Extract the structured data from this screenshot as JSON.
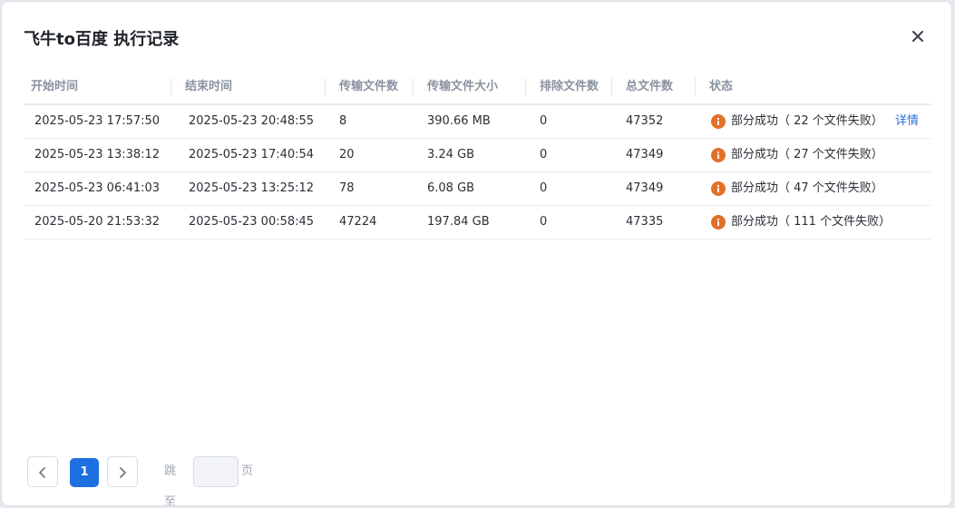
{
  "dialog": {
    "title": "飞牛to百度 执行记录"
  },
  "table": {
    "headers": [
      "开始时间",
      "结束时间",
      "传输文件数",
      "传输文件大小",
      "排除文件数",
      "总文件数",
      "状态"
    ],
    "rows": [
      {
        "start": "2025-05-23 17:57:50",
        "end": "2025-05-23 20:48:55",
        "transferred": "8",
        "size": "390.66 MB",
        "excluded": "0",
        "total": "47352",
        "status": "部分成功（ 22 个文件失败）",
        "detail": "详情"
      },
      {
        "start": "2025-05-23 13:38:12",
        "end": "2025-05-23 17:40:54",
        "transferred": "20",
        "size": "3.24 GB",
        "excluded": "0",
        "total": "47349",
        "status": "部分成功（ 27 个文件失败）"
      },
      {
        "start": "2025-05-23 06:41:03",
        "end": "2025-05-23 13:25:12",
        "transferred": "78",
        "size": "6.08 GB",
        "excluded": "0",
        "total": "47349",
        "status": "部分成功（ 47 个文件失败）"
      },
      {
        "start": "2025-05-20 21:53:32",
        "end": "2025-05-23 00:58:45",
        "transferred": "47224",
        "size": "197.84 GB",
        "excluded": "0",
        "total": "47335",
        "status": "部分成功（ 111 个文件失败）"
      }
    ]
  },
  "pager": {
    "current_page": "1",
    "jump_prefix": "跳至",
    "jump_suffix": "页",
    "jump_value": ""
  },
  "colors": {
    "accent": "#1e6fe0",
    "warning": "#e0702a",
    "link": "#2d6fd8"
  },
  "icons": {
    "close": "close-icon",
    "status": "warning-info-icon",
    "prev": "chevron-left-icon",
    "next": "chevron-right-icon"
  }
}
